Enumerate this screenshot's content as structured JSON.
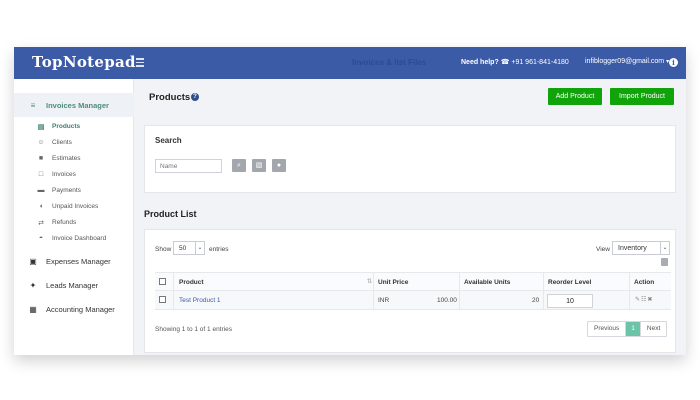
{
  "header": {
    "logo": "TopNotepad",
    "faint_title": "Invoices & list Files",
    "help_label": "Need help?",
    "phone": "☎ +91 961-841-4180",
    "user_email": "infiblogger09@gmail.com",
    "info_icon_glyph": "i"
  },
  "sidebar": {
    "sections": [
      {
        "label": "Invoices Manager",
        "icon": "layers-icon",
        "glyph": "≡",
        "active": true
      },
      {
        "label": "Expenses Manager",
        "icon": "wallet-icon",
        "glyph": "▣",
        "active": false
      },
      {
        "label": "Leads Manager",
        "icon": "handshake-icon",
        "glyph": "✦",
        "active": false
      },
      {
        "label": "Accounting Manager",
        "icon": "chart-icon",
        "glyph": "▦",
        "active": false
      }
    ],
    "invoice_items": [
      {
        "label": "Products",
        "icon": "products-icon",
        "glyph": "▤",
        "active": true
      },
      {
        "label": "Clients",
        "icon": "clients-icon",
        "glyph": "☺",
        "active": false
      },
      {
        "label": "Estimates",
        "icon": "estimates-icon",
        "glyph": "■",
        "active": false
      },
      {
        "label": "Invoices",
        "icon": "invoice-icon",
        "glyph": "□",
        "active": false
      },
      {
        "label": "Payments",
        "icon": "card-icon",
        "glyph": "▬",
        "active": false
      },
      {
        "label": "Unpaid Invoices",
        "icon": "shield-icon",
        "glyph": "◖",
        "active": false
      },
      {
        "label": "Refunds",
        "icon": "refund-icon",
        "glyph": "⇄",
        "active": false
      },
      {
        "label": "Invoice Dashboard",
        "icon": "dashboard-icon",
        "glyph": "◓",
        "active": false
      }
    ]
  },
  "page": {
    "title": "Products",
    "help_glyph": "?",
    "add_button": "Add Product",
    "import_button": "Import Product"
  },
  "search": {
    "title": "Search",
    "placeholder": "Name",
    "search_glyph": "⌕",
    "export_glyph": "▧",
    "reset_glyph": "●"
  },
  "list": {
    "title": "Product List",
    "show_label": "Show",
    "page_size": "50",
    "entries_label": "entries",
    "view_label": "View",
    "view_value": "Inventory",
    "dropdown_glyph": "⌄",
    "columns": [
      "Product",
      "Unit Price",
      "Available Units",
      "Reorder Level",
      "Action"
    ],
    "sort_glyph": "⇅",
    "rows": [
      {
        "product": "Test Product 1",
        "currency": "INR",
        "price": "100.00",
        "units": "20",
        "reorder": "10",
        "actions": "✎☷✖"
      }
    ],
    "showing_text": "Showing 1 to 1 of 1 entries",
    "pagination": {
      "prev": "Previous",
      "current": "1",
      "next": "Next"
    }
  },
  "colors": {
    "topbar": "#3c5ba7",
    "accent_green": "#11a30a",
    "active_sidebar": "#4d8d7c",
    "pagination_current": "#6cc4a8"
  }
}
